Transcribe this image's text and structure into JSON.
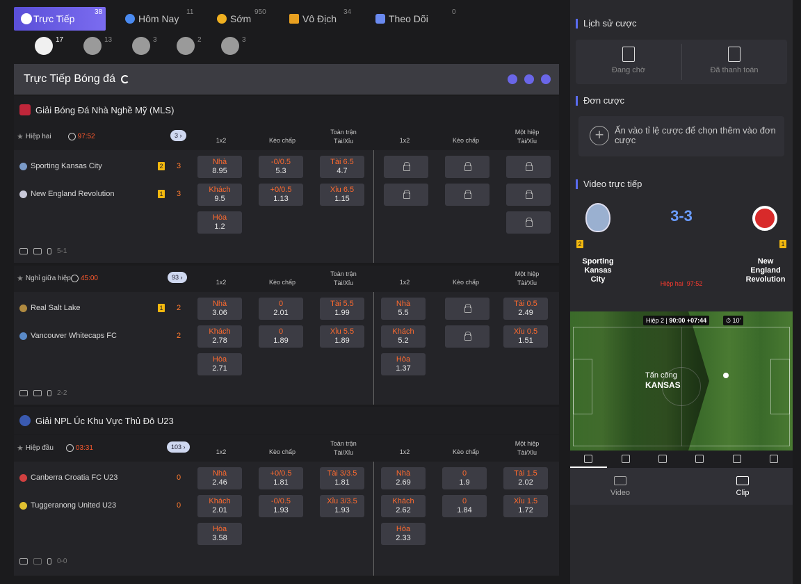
{
  "tabs": [
    {
      "label": "Trực Tiếp",
      "count": "38"
    },
    {
      "label": "Hôm Nay",
      "count": "11"
    },
    {
      "label": "Sớm",
      "count": "950"
    },
    {
      "label": "Vô Địch",
      "count": "34"
    },
    {
      "label": "Theo Dõi",
      "count": "0"
    }
  ],
  "sports": [
    {
      "icon": "soccer-ball-icon",
      "count": "17"
    },
    {
      "icon": "basketball-icon",
      "count": "13"
    },
    {
      "icon": "tennis-ball-icon",
      "count": "3"
    },
    {
      "icon": "volleyball-icon",
      "count": "2"
    },
    {
      "icon": "table-tennis-icon",
      "count": "3"
    }
  ],
  "header": {
    "title": "Trực Tiếp Bóng đá"
  },
  "columns": {
    "c1": "1x2",
    "c2": "Kèo chấp",
    "c3a": "Toàn trận",
    "c3b": "Tài/Xỉu",
    "c4": "1x2",
    "c5": "Kèo chấp",
    "c6a": "Một hiệp",
    "c6b": "Tài/Xỉu"
  },
  "leagues": [
    {
      "name": "Giải Bóng Đá Nhà Nghề Mỹ (MLS)"
    },
    {
      "name": "Giải NPL Úc Khu Vực Thủ Đô U23"
    }
  ],
  "matches": [
    {
      "status": "Hiệp hai",
      "time": "97:52",
      "more": "3",
      "home": "Sporting Kansas City",
      "home_rc": "2",
      "home_score": "3",
      "away": "New England Revolution",
      "away_rc": "1",
      "away_score": "3",
      "ft_1x2": [
        {
          "l": "Nhà",
          "v": "8.95"
        },
        {
          "l": "Khách",
          "v": "9.5"
        },
        {
          "l": "Hòa",
          "v": "1.2"
        }
      ],
      "ft_hdp": [
        {
          "l": "-0/0.5",
          "v": "5.3"
        },
        {
          "l": "+0/0.5",
          "v": "1.13"
        }
      ],
      "ft_ou": [
        {
          "l": "Tài 6.5",
          "v": "4.7"
        },
        {
          "l": "Xỉu 6.5",
          "v": "1.15"
        }
      ],
      "foot": "5-1"
    },
    {
      "status": "Nghỉ giữa hiệp",
      "time": "45:00",
      "more": "93",
      "home": "Real Salt Lake",
      "home_rc": "1",
      "home_score": "2",
      "away": "Vancouver Whitecaps FC",
      "away_rc": "",
      "away_score": "2",
      "ft_1x2": [
        {
          "l": "Nhà",
          "v": "3.06"
        },
        {
          "l": "Khách",
          "v": "2.78"
        },
        {
          "l": "Hòa",
          "v": "2.71"
        }
      ],
      "ft_hdp": [
        {
          "l": "0",
          "v": "2.01"
        },
        {
          "l": "0",
          "v": "1.89"
        }
      ],
      "ft_ou": [
        {
          "l": "Tài 5.5",
          "v": "1.99"
        },
        {
          "l": "Xỉu 5.5",
          "v": "1.89"
        }
      ],
      "h1_1x2": [
        {
          "l": "Nhà",
          "v": "5.5"
        },
        {
          "l": "Khách",
          "v": "5.2"
        },
        {
          "l": "Hòa",
          "v": "1.37"
        }
      ],
      "h1_ou": [
        {
          "l": "Tài 0.5",
          "v": "2.49"
        },
        {
          "l": "Xỉu 0.5",
          "v": "1.51"
        }
      ],
      "foot": "2-2"
    },
    {
      "status": "Hiệp đầu",
      "time": "03:31",
      "more": "103",
      "home": "Canberra Croatia FC U23",
      "home_rc": "",
      "home_score": "0",
      "away": "Tuggeranong United U23",
      "away_rc": "",
      "away_score": "0",
      "ft_1x2": [
        {
          "l": "Nhà",
          "v": "2.46"
        },
        {
          "l": "Khách",
          "v": "2.01"
        },
        {
          "l": "Hòa",
          "v": "3.58"
        }
      ],
      "ft_hdp": [
        {
          "l": "+0/0.5",
          "v": "1.81"
        },
        {
          "l": "-0/0.5",
          "v": "1.93"
        }
      ],
      "ft_ou": [
        {
          "l": "Tài 3/3.5",
          "v": "1.81"
        },
        {
          "l": "Xỉu 3/3.5",
          "v": "1.93"
        }
      ],
      "h1_1x2": [
        {
          "l": "Nhà",
          "v": "2.69"
        },
        {
          "l": "Khách",
          "v": "2.62"
        },
        {
          "l": "Hòa",
          "v": "2.33"
        }
      ],
      "h1_hdp": [
        {
          "l": "0",
          "v": "1.9"
        },
        {
          "l": "0",
          "v": "1.84"
        }
      ],
      "h1_ou": [
        {
          "l": "Tài 1.5",
          "v": "2.02"
        },
        {
          "l": "Xỉu 1.5",
          "v": "1.72"
        }
      ],
      "foot": "0-0"
    }
  ],
  "right": {
    "history_title": "Lịch sử cược",
    "pending": "Đang chờ",
    "settled": "Đã thanh toán",
    "slip_title": "Đơn cược",
    "slip_hint": "Ấn vào tỉ lệ cược để chọn thêm vào đơn cược",
    "video_title": "Video trực tiếp",
    "score": "3-3",
    "home": "Sporting Kansas City",
    "home_rc": "2",
    "away": "New England Revolution",
    "away_rc": "1",
    "phase": "Hiệp hai",
    "phase_time": "97:52",
    "pitch_half": "Hiệp 2",
    "pitch_time": "90:00 +07:44",
    "pitch_clock": "10'",
    "attack_label": "Tấn công",
    "attack_team": "KANSAS",
    "video_label": "Video",
    "clip_label": "Clip"
  },
  "colors": {
    "accent": "#6a5cf0",
    "odd_label": "#ff6a2e",
    "score": "#6a9cff",
    "live_time": "#ff5a2e"
  }
}
